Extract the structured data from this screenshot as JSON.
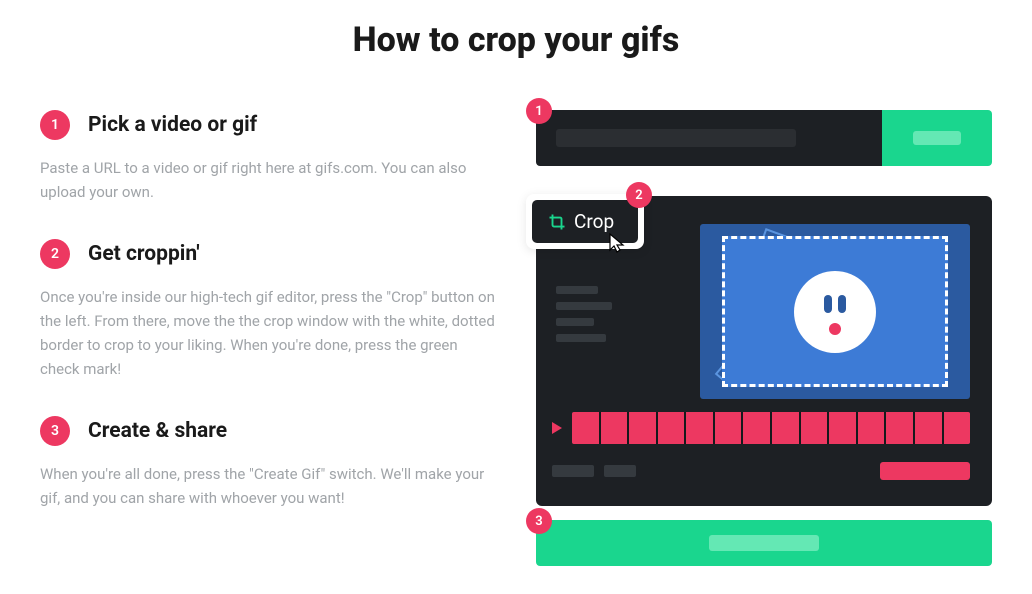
{
  "title": "How to crop your gifs",
  "steps": [
    {
      "num": "1",
      "title": "Pick a video or gif",
      "desc": "Paste a URL to a video or gif right here at gifs.com. You can also upload your own."
    },
    {
      "num": "2",
      "title": "Get croppin'",
      "desc": "Once you're inside our high-tech gif editor, press the \"Crop\" button on the left. From there, move the the crop window with the white, dotted border to crop to your liking. When you're done, press the green check mark!"
    },
    {
      "num": "3",
      "title": "Create & share",
      "desc": "When you're all done, press the \"Create Gif\" switch. We'll make your gif, and you can share with whoever you want!"
    }
  ],
  "crop_label": "Crop",
  "illus_badges": {
    "b1": "1",
    "b2": "2",
    "b3": "3"
  },
  "colors": {
    "accent_pink": "#ed3861",
    "accent_green": "#1ad68e",
    "dark": "#1d2024",
    "canvas_blue": "#3d7bd6"
  }
}
